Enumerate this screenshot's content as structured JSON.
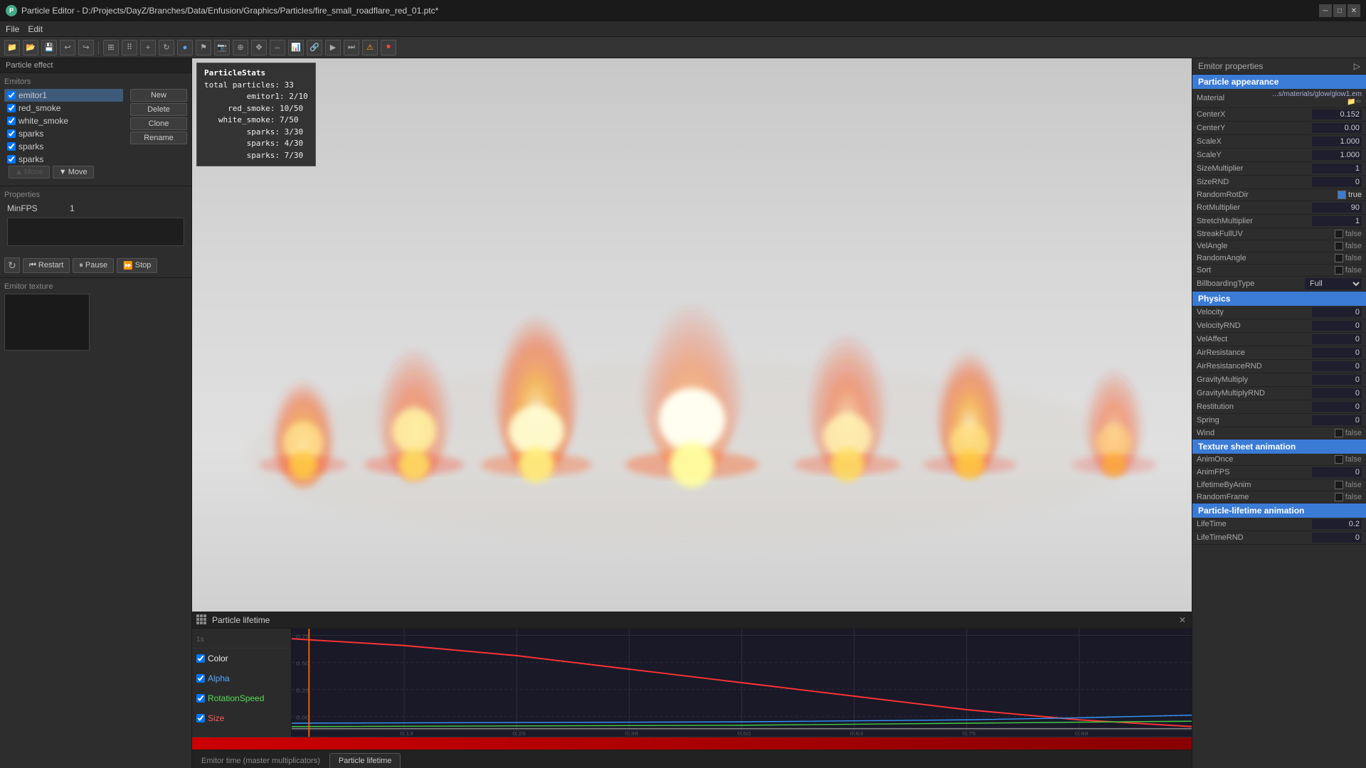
{
  "titlebar": {
    "title": "Particle Editor - D:/Projects/DayZ/Branches/Data/Enfusion/Graphics/Particles/fire_small_roadflare_red_01.ptc*",
    "icon": "P",
    "minimize": "─",
    "maximize": "□",
    "close": "✕"
  },
  "menu": {
    "items": [
      "File",
      "Edit"
    ]
  },
  "panel_title": "Particle effect",
  "emitors_label": "Emitors",
  "emitors": [
    {
      "id": "e1",
      "checked": true,
      "name": "emitor1",
      "selected": true
    },
    {
      "id": "e2",
      "checked": true,
      "name": "red_smoke"
    },
    {
      "id": "e3",
      "checked": true,
      "name": "white_smoke"
    },
    {
      "id": "e4",
      "checked": true,
      "name": "sparks"
    },
    {
      "id": "e5",
      "checked": true,
      "name": "sparks"
    },
    {
      "id": "e6",
      "checked": true,
      "name": "sparks"
    }
  ],
  "buttons": {
    "new": "New",
    "delete": "Delete",
    "clone": "Clone",
    "rename": "Rename",
    "move_up": "▲  Move",
    "move_down": "▼  Move"
  },
  "properties": {
    "label": "Properties",
    "items": [
      {
        "name": "MinFPS",
        "value": "1"
      }
    ]
  },
  "playback": {
    "restart": "Restart",
    "pause": "Pause",
    "stop": "Stop"
  },
  "emitor_texture": {
    "label": "Emitor texture"
  },
  "particle_stats": {
    "title": "ParticleStats",
    "lines": [
      "total particles: 33",
      "emitor1: 2/10",
      "red_smoke: 10/50",
      "white_smoke: 7/50",
      "sparks: 3/30",
      "sparks: 4/30",
      "sparks: 7/30"
    ]
  },
  "bottom_panel": {
    "title": "Particle lifetime",
    "tracks": [
      {
        "checked": true,
        "name": "Color",
        "color": "white"
      },
      {
        "checked": true,
        "name": "Alpha",
        "color": "blue"
      },
      {
        "checked": true,
        "name": "RotationSpeed",
        "color": "green"
      },
      {
        "checked": true,
        "name": "Size",
        "color": "red"
      }
    ],
    "tabs": [
      {
        "label": "Emitor time (master multiplicators)",
        "active": false
      },
      {
        "label": "Particle lifetime",
        "active": true
      }
    ],
    "timeline_markers": [
      "0.13",
      "0.25",
      "0.38",
      "0.50",
      "0.63",
      "0.75",
      "0.88"
    ],
    "y_markers": [
      "0.75",
      "0.50",
      "0.25",
      "0.00"
    ]
  },
  "right_panel": {
    "header": "Emitor properties",
    "sections": [
      {
        "title": "Particle appearance",
        "color": "blue",
        "props": [
          {
            "name": "Material",
            "value": "...s/materials/glow/glow1.em",
            "type": "text"
          },
          {
            "name": "CenterX",
            "value": "0.152",
            "type": "input"
          },
          {
            "name": "CenterY",
            "value": "0.00",
            "type": "input"
          },
          {
            "name": "ScaleX",
            "value": "1.000",
            "type": "input"
          },
          {
            "name": "ScaleY",
            "value": "1.000",
            "type": "input"
          },
          {
            "name": "SizeMultiplier",
            "value": "1",
            "type": "input"
          },
          {
            "name": "SizeRND",
            "value": "0",
            "type": "input"
          },
          {
            "name": "RandomRotDir",
            "value": "true",
            "type": "checkbox",
            "checked": true
          },
          {
            "name": "RotMultiplier",
            "value": "90",
            "type": "input"
          },
          {
            "name": "StretchMultiplier",
            "value": "1",
            "type": "input"
          },
          {
            "name": "StreakFullUV",
            "value": "false",
            "type": "checkbox",
            "checked": false
          },
          {
            "name": "VelAngle",
            "value": "false",
            "type": "checkbox",
            "checked": false
          },
          {
            "name": "RandomAngle",
            "value": "false",
            "type": "checkbox",
            "checked": false
          },
          {
            "name": "Sort",
            "value": "false",
            "type": "checkbox",
            "checked": false
          },
          {
            "name": "BillboardingType",
            "value": "Full",
            "type": "select"
          }
        ]
      },
      {
        "title": "Physics",
        "color": "blue",
        "props": [
          {
            "name": "Velocity",
            "value": "0",
            "type": "input"
          },
          {
            "name": "VelocityRND",
            "value": "0",
            "type": "input"
          },
          {
            "name": "VelAffect",
            "value": "0",
            "type": "input"
          },
          {
            "name": "AirResistance",
            "value": "0",
            "type": "input"
          },
          {
            "name": "AirResistanceRND",
            "value": "0",
            "type": "input"
          },
          {
            "name": "GravityMultiply",
            "value": "0",
            "type": "input"
          },
          {
            "name": "GravityMultiplyRND",
            "value": "0",
            "type": "input"
          },
          {
            "name": "Restitution",
            "value": "0",
            "type": "input"
          },
          {
            "name": "Spring",
            "value": "0",
            "type": "input"
          },
          {
            "name": "Wind",
            "value": "false",
            "type": "checkbox",
            "checked": false
          }
        ]
      },
      {
        "title": "Texture sheet animation",
        "color": "blue",
        "props": [
          {
            "name": "AnimOnce",
            "value": "false",
            "type": "checkbox",
            "checked": false
          },
          {
            "name": "AnimFPS",
            "value": "0",
            "type": "input"
          },
          {
            "name": "LifetimeByAnim",
            "value": "false",
            "type": "checkbox",
            "checked": false
          },
          {
            "name": "RandomFrame",
            "value": "false",
            "type": "checkbox",
            "checked": false
          }
        ]
      },
      {
        "title": "Particle-lifetime animation",
        "color": "blue",
        "props": [
          {
            "name": "LifeTime",
            "value": "0.2",
            "type": "input"
          },
          {
            "name": "LifeTimeRND",
            "value": "0",
            "type": "input"
          }
        ]
      }
    ]
  }
}
